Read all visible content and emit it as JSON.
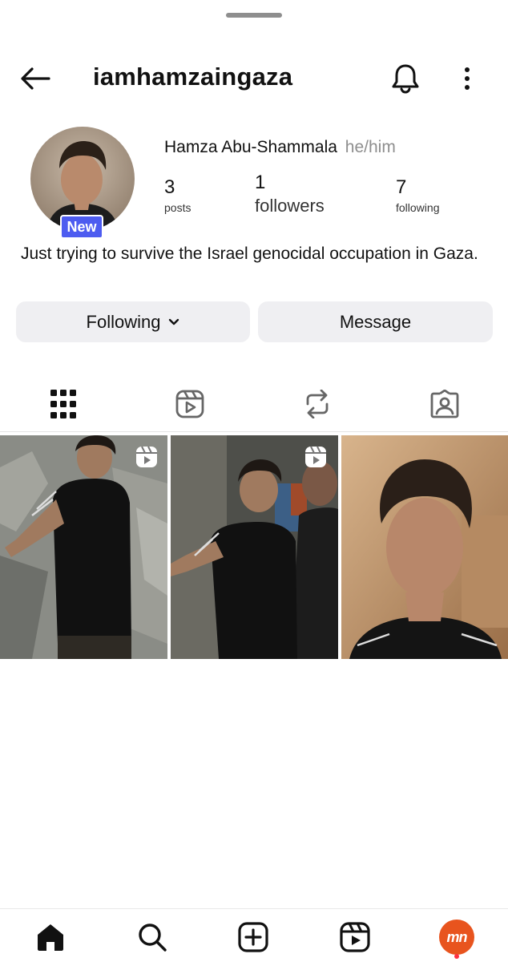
{
  "header": {
    "username": "iamhamzaingaza",
    "back_icon": "arrow-left-icon",
    "bell_icon": "bell-icon",
    "more_icon": "more-vertical-icon"
  },
  "profile": {
    "badge": "New",
    "full_name": "Hamza Abu-Shammala",
    "pronouns": "he/him",
    "stats": {
      "posts_count": "3",
      "posts_label": "posts",
      "followers_count": "1",
      "followers_label": "followers",
      "following_count": "7",
      "following_label": "following"
    },
    "bio": "Just trying to survive the Israel genocidal occupation in Gaza."
  },
  "actions": {
    "following_label": "Following",
    "message_label": "Message"
  },
  "tabs": [
    {
      "name": "tab-grid",
      "icon": "grid-icon",
      "active": true
    },
    {
      "name": "tab-reels",
      "icon": "reels-icon",
      "active": false
    },
    {
      "name": "tab-reposts",
      "icon": "repost-icon",
      "active": false
    },
    {
      "name": "tab-tagged",
      "icon": "tagged-person-icon",
      "active": false
    }
  ],
  "posts": [
    {
      "type": "reel"
    },
    {
      "type": "reel"
    },
    {
      "type": "photo"
    }
  ],
  "bottom_nav": {
    "items": [
      "home-icon",
      "search-icon",
      "create-icon",
      "reels-icon",
      "profile-avatar"
    ],
    "profile_avatar_text": "mn"
  },
  "colors": {
    "badge_blue": "#4d5cf0",
    "button_gray": "#efeff2",
    "profile_orange": "#e8541e",
    "notification_red": "#ff3040"
  }
}
